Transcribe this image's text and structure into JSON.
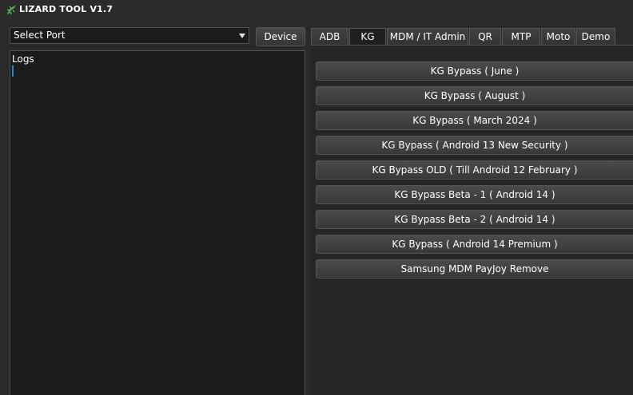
{
  "window": {
    "title": "LIZARD TOOL V1.7",
    "icon": "lizard-icon"
  },
  "port": {
    "value": "Select Port"
  },
  "device_button": "Device",
  "logs": {
    "title": "Logs"
  },
  "tabs": [
    {
      "label": "ADB",
      "active": false
    },
    {
      "label": "KG",
      "active": true
    },
    {
      "label": "MDM / IT Admin",
      "active": false
    },
    {
      "label": "QR",
      "active": false
    },
    {
      "label": "MTP",
      "active": false
    },
    {
      "label": "Moto",
      "active": false
    },
    {
      "label": "Demo",
      "active": false
    }
  ],
  "kg_buttons": [
    "KG Bypass ( June )",
    "KG Bypass  ( August )",
    "KG Bypass ( March 2024 )",
    "KG Bypass ( Android 13 New Security )",
    "KG Bypass OLD ( Till Android 12 February )",
    "KG Bypass Beta - 1 ( Android 14  )",
    "KG Bypass Beta - 2 ( Android 14  )",
    "KG Bypass ( Android 14  Premium )",
    "Samsung MDM PayJoy Remove"
  ],
  "colors": {
    "background": "#2a2a2a",
    "panel": "#1b1b1b",
    "accent": "#2f7ed8",
    "icon_green": "#4caf50"
  }
}
